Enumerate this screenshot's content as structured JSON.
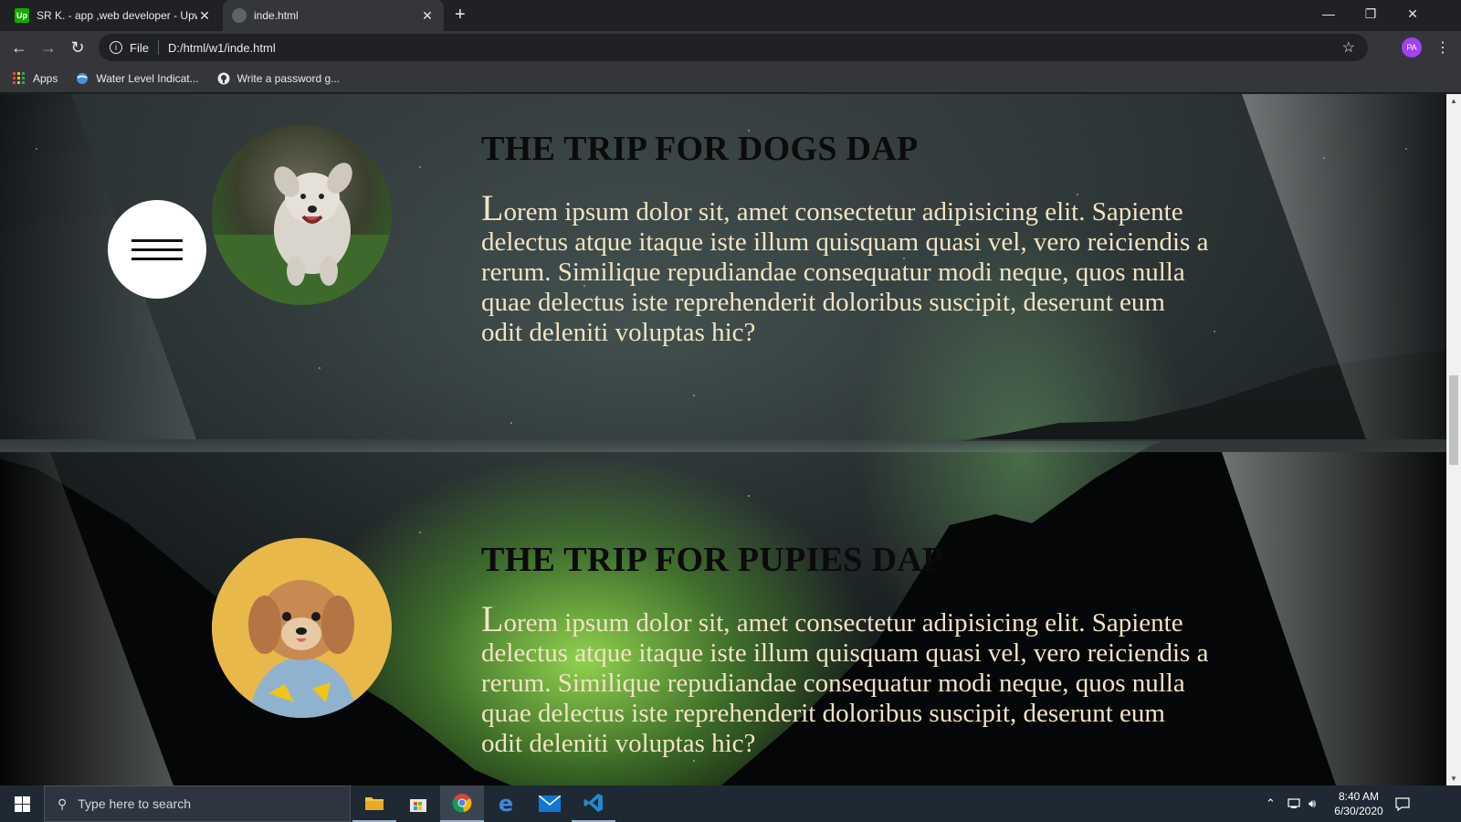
{
  "browser": {
    "tabs": [
      {
        "title": "SR K. - app ,web developer - Upwork",
        "favicon": "Up",
        "close": "✕"
      },
      {
        "title": "inde.html",
        "favicon": "",
        "close": "✕"
      }
    ],
    "new_tab": "+",
    "window_controls": {
      "minimize": "—",
      "restore": "❐",
      "close": "✕"
    },
    "address": {
      "protocol": "File",
      "url": "D:/html/w1/inde.html"
    },
    "profile_initials": "PA",
    "bookmarks": [
      {
        "label": "Apps"
      },
      {
        "label": "Water Level Indicat..."
      },
      {
        "label": "Write a password g..."
      }
    ]
  },
  "page": {
    "sections": [
      {
        "title": "THE TRIP FOR DOGS DAP",
        "dropcap": "L",
        "text": "orem ipsum dolor sit, amet consectetur adipisicing elit. Sapiente delectus atque itaque iste illum quisquam quasi vel, vero reiciendis a rerum. Similique repudiandae consequatur modi neque, quos nulla quae delectus iste reprehenderit doloribus suscipit, deserunt eum odit deleniti voluptas hic?"
      },
      {
        "title": "THE TRIP FOR PUPIES DAP",
        "dropcap": "L",
        "text": "orem ipsum dolor sit, amet consectetur adipisicing elit. Sapiente delectus atque itaque iste illum quisquam quasi vel, vero reiciendis a rerum. Similique repudiandae consequatur modi neque, quos nulla quae delectus iste reprehenderit doloribus suscipit, deserunt eum odit deleniti voluptas hic?"
      }
    ],
    "colors": {
      "heading": "#0b0b0b",
      "paragraph": "#f2e3c4",
      "aurora": "#96dc50"
    }
  },
  "taskbar": {
    "search_placeholder": "Type here to search",
    "apps": [
      "file-explorer-icon",
      "store-icon",
      "chrome-icon",
      "edge-icon",
      "mail-icon",
      "vscode-icon"
    ],
    "time": "8:40 AM",
    "date": "6/30/2020"
  }
}
